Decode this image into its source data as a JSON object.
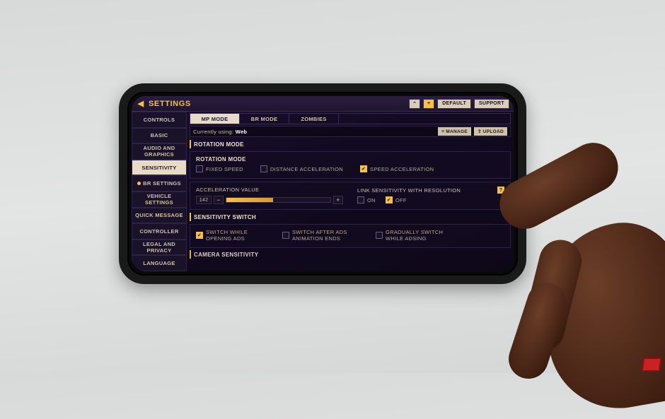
{
  "header": {
    "title": "SETTINGS",
    "default_btn": "DEFAULT",
    "support_btn": "SUPPORT"
  },
  "sidebar": {
    "items": [
      "CONTROLS",
      "BASIC",
      "AUDIO AND GRAPHICS",
      "SENSITIVITY",
      "BR SETTINGS",
      "VEHICLE SETTINGS",
      "QUICK MESSAGE",
      "CONTROLLER",
      "LEGAL AND PRIVACY",
      "LANGUAGE"
    ],
    "active_index": 3,
    "br_dot_index": 4
  },
  "tabs": {
    "items": [
      "MP MODE",
      "BR MODE",
      "ZOMBIES"
    ],
    "active_index": 0
  },
  "current_bar": {
    "label": "Currently using:",
    "value": "Web",
    "manage_btn": "MANAGE",
    "upload_btn": "UPLOAD"
  },
  "rotation": {
    "section_title": "ROTATION MODE",
    "mode_label": "ROTATION MODE",
    "opts": {
      "fixed": "FIXED SPEED",
      "distance": "DISTANCE ACCELERATION",
      "speed": "SPEED ACCELERATION"
    },
    "selected": "speed",
    "accel_label": "ACCELERATION VALUE",
    "accel_value": "142",
    "link_label": "LINK SENSITIVITY WITH RESOLUTION",
    "on_label": "ON",
    "off_label": "OFF",
    "link_value": "off"
  },
  "sens_switch": {
    "section_title": "SENSITIVITY SWITCH",
    "opts": {
      "open_ads": "SWITCH WHILE OPENING ADS",
      "after_anim": "SWITCH AFTER ADS ANIMATION ENDS",
      "gradual": "GRADUALLY SWITCH WHILE ADSING"
    },
    "selected": "open_ads"
  },
  "next_section_title": "CAMERA SENSITIVITY"
}
